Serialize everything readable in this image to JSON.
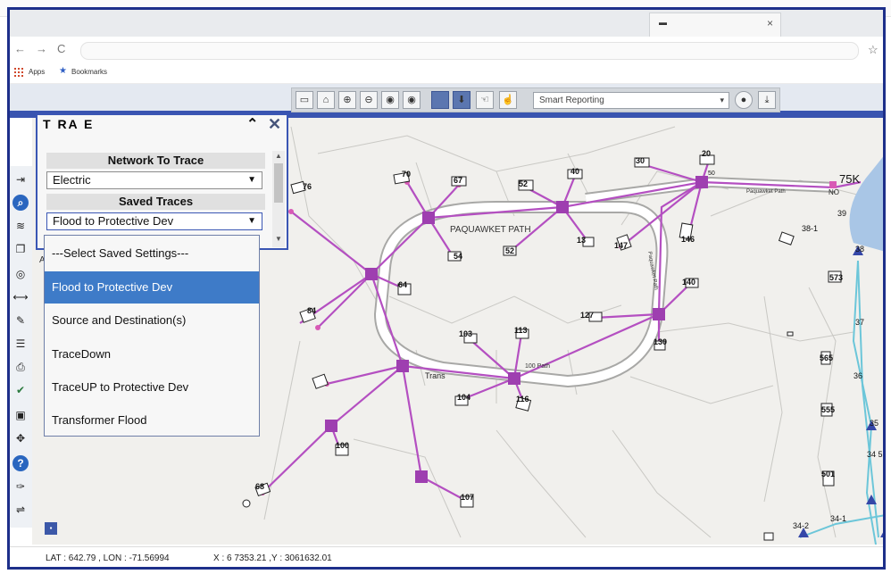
{
  "browser": {
    "tab_title": "▬",
    "tab_close": "×",
    "back": "←",
    "forward": "→",
    "reload": "C",
    "star": "☆",
    "bookmarks": {
      "apps": "Apps",
      "bookmarks": "Bookmarks"
    }
  },
  "toolbar": {
    "smart_reporting": "Smart Reporting",
    "caret": "▾"
  },
  "trace_panel": {
    "title": "T  RA  E",
    "chevron": "⌃",
    "close": "✕",
    "network_header": "Network To Trace",
    "network_value": "Electric",
    "saved_header": "Saved Traces",
    "saved_value": "Flood to Protective Dev",
    "caret": "▼"
  },
  "dropdown": {
    "options": [
      "---Select Saved Settings---",
      "Flood to Protective Dev",
      "Source and Destination(s)",
      "TraceDown",
      "TraceUP to Protective Dev",
      "Transformer Flood"
    ],
    "selected_index": 1
  },
  "side_label": "A",
  "map": {
    "street_1": "PAQUAWKET PATH",
    "street_2": "Paquawket Path",
    "street_3": "100 Path",
    "street_4": "Paquawket Path",
    "trans": "Trans",
    "no_label": "NO",
    "feed_label": "75K",
    "parcels": [
      "76",
      "70",
      "67",
      "52",
      "40",
      "30",
      "20",
      "147",
      "146",
      "38-1",
      "573",
      "140",
      "127",
      "113",
      "103",
      "565",
      "54",
      "52",
      "13",
      "555",
      "64",
      "104",
      "116",
      "130",
      "36",
      "84",
      "501",
      "100",
      "34 5",
      "34-2",
      "34-1",
      "107",
      "68",
      "37",
      "39",
      "35",
      "38",
      "50"
    ]
  },
  "status": {
    "latlon": "LAT :     642.79 , LON : -71.56994",
    "xy": "X : 6  7353.21  ,Y : 3061632.01"
  },
  "colors": {
    "accent": "#3a56b4",
    "trace": "#b44fc1",
    "selected": "#3e7bc8",
    "line2": "#6cc6d9"
  }
}
